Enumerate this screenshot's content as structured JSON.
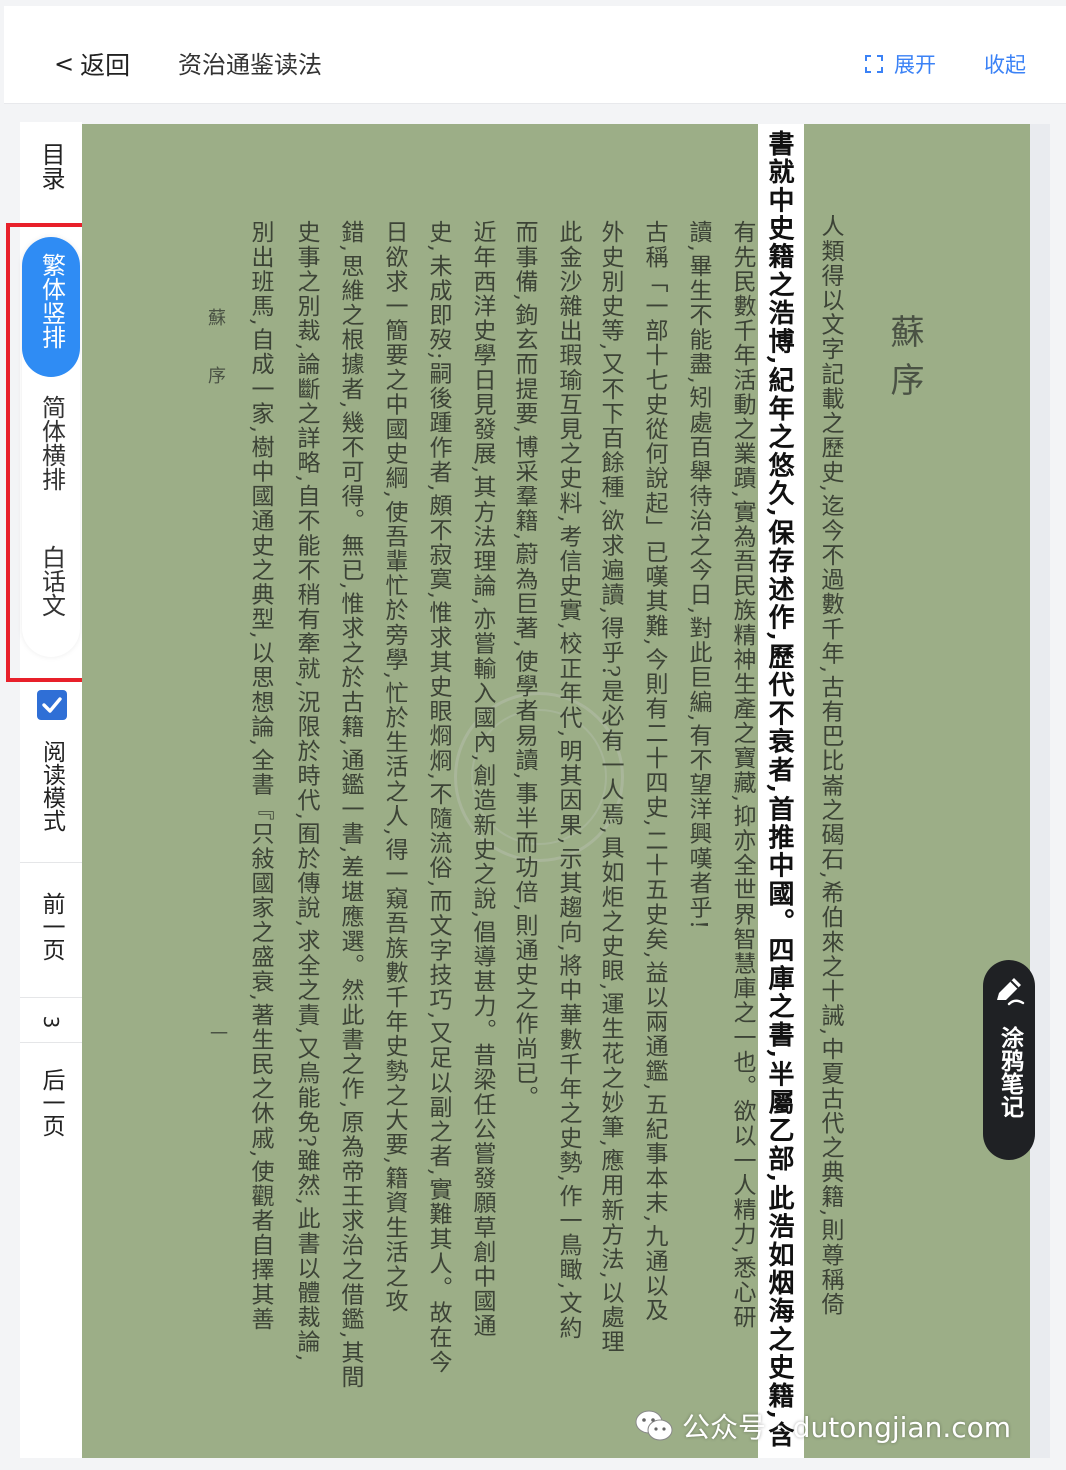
{
  "header": {
    "back_label": "返回",
    "title": "资治通鉴读法",
    "expand_label": "展开",
    "collapse_label": "收起"
  },
  "sidebar": {
    "toc_label": "目录",
    "modes": [
      {
        "label": "繁体竖排",
        "active": true
      },
      {
        "label": "简体横排",
        "active": false
      },
      {
        "label": "白话文",
        "active": false
      }
    ],
    "read_mode_label": "阅读模式",
    "read_mode_checked": true,
    "prev_label": "前一页",
    "page_number": "3",
    "next_label": "后一页"
  },
  "page": {
    "title": "蘇序",
    "columns": [
      "人類得以文字記載之歷史,迄今不過數千年,古有巴比崙之碣石,希伯來之十誡,中夏古代之典籍,則尊稱倚",
      "書就中史籍之浩博,紀年之悠久,保存述作,歷代不衰者,首推中國。四庫之書,半屬乙部,此浩如烟海之史籍,含",
      "有先民數千年活動之業蹟,實為吾民族精神生產之寶藏,抑亦全世界智慧庫之一也。欲以一人精力,悉心研",
      "讀,畢生不能盡,矧處百舉待治之今日,對此巨編,有不望洋興嘆者乎!",
      "古稱「一部十七史從何說起」已嘆其難,今則有二十四史,二十五史矣,益以兩通鑑,五紀事本末,九通以及",
      "外史別史等,又不下百餘種,欲求遍讀,得乎?是必有一人焉,具如炬之史眼,運生花之妙筆,應用新方法,以處理",
      "此金沙雜出瑕瑜互見之史料,考信史實,校正年代,明其因果,示其趨向,將中華數千年之史勢,作一鳥瞰,文約",
      "而事備,鉤玄而提要,博采羣籍,蔚為巨著,使學者易讀,事半而功倍,則通史之作尚已。",
      "近年西洋史學日見發展,其方法理論,亦嘗輸入國內,創造新史之說,倡導甚力。昔梁任公嘗發願草創中國通",
      "史,未成即歿;嗣後踵作者,頗不寂寞,惟求其史眼烱烱,不隨流俗,而文字技巧,又足以副之者,實難其人。故在今",
      "日欲求一簡要之中國史綱,使吾輩忙於旁學,忙於生活之人,得一窺吾族數千年史勢之大要,籍資生活之攻",
      "錯,思維之根據者,幾不可得。無已,惟求之於古籍,通鑑一書,差堪應選。然此書之作,原為帝王求治之借鑑,其間",
      "史事之別裁,論斷之詳略,自不能不稍有牽就,況限於時代,囿於傳說,求全之責,又烏能免?雖然,此書以體裁論,",
      "別出班馬,自成一家,樹中國通史之典型,以思想論,全書『只敍國家之盛衰,著生民之休戚,使觀者自擇其善"
    ],
    "footer_left": "蘇序",
    "page_marker": "一"
  },
  "doodle": {
    "label": "涂鸦笔记"
  },
  "watermark": {
    "text": "公众号 · dutongjian.com"
  }
}
